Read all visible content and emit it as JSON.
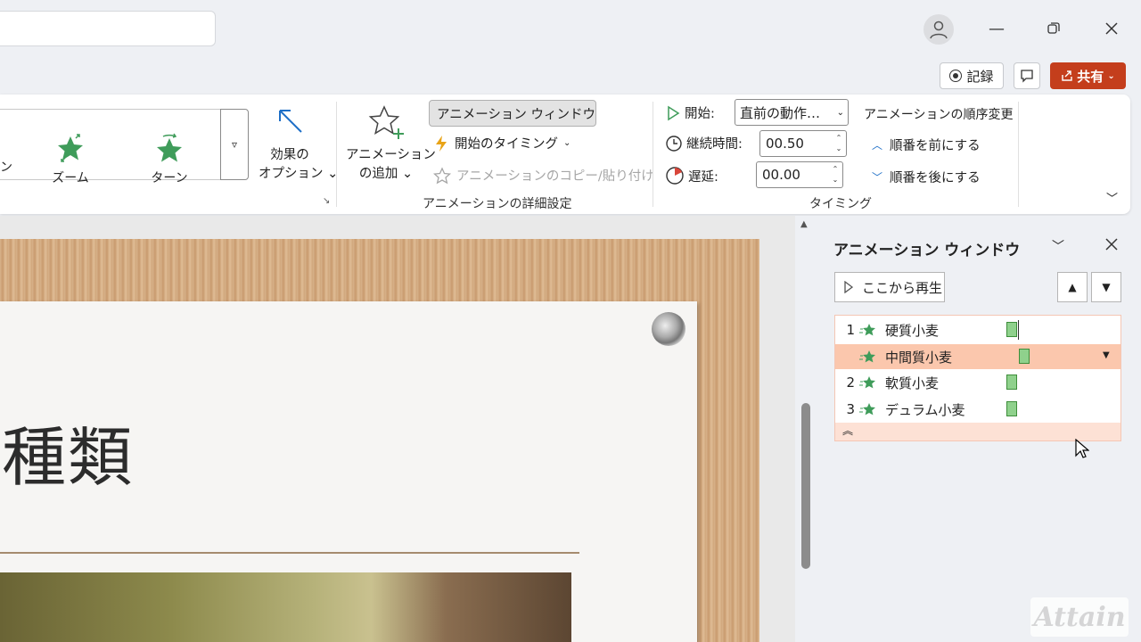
{
  "titlebar": {
    "window_controls": [
      "minimize-icon",
      "restore-icon",
      "close-icon"
    ]
  },
  "header_buttons": {
    "record": "記録",
    "share": "共有"
  },
  "ribbon": {
    "gallery": {
      "partial_item": "ン",
      "items": [
        {
          "label": "ズーム",
          "icon": "zoom-star-icon"
        },
        {
          "label": "ターン",
          "icon": "turn-star-icon"
        }
      ]
    },
    "effect_options": {
      "line1": "効果の",
      "line2": "オプション"
    },
    "add_animation": {
      "line1": "アニメーション",
      "line2": "の追加"
    },
    "animation_window_btn": "アニメーション ウィンドウ",
    "trigger": "開始のタイミング",
    "copy_paste": "アニメーションのコピー/貼り付け",
    "advanced_group_label": "アニメーションの詳細設定",
    "timing": {
      "start_label": "開始:",
      "start_value": "直前の動作…",
      "duration_label": "継続時間:",
      "duration_value": "00.50",
      "delay_label": "遅延:",
      "delay_value": "00.00",
      "reorder_title": "アニメーションの順序変更",
      "move_earlier": "順番を前にする",
      "move_later": "順番を後にする",
      "group_label": "タイミング"
    }
  },
  "slide": {
    "title_partial": "種類"
  },
  "animation_pane": {
    "title": "アニメーション ウィンドウ",
    "play_from": "ここから再生",
    "items": [
      {
        "num": "1",
        "label": "硬質小麦"
      },
      {
        "num": "",
        "label": "中間質小麦"
      },
      {
        "num": "2",
        "label": "軟質小麦"
      },
      {
        "num": "3",
        "label": "デュラム小麦"
      }
    ]
  },
  "watermark": "Attain",
  "colors": {
    "share": "#c43e1c",
    "selected_row": "#fbc7ad",
    "accent_blue": "#1e6fc7"
  }
}
